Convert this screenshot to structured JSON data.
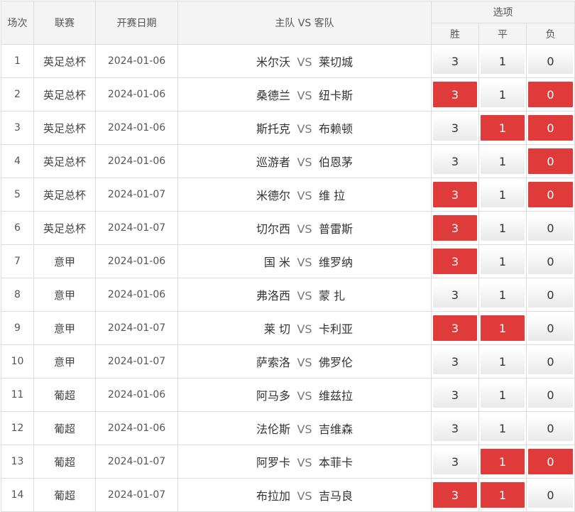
{
  "header": {
    "index": "场次",
    "league": "联赛",
    "date": "开赛日期",
    "matchup": "主队 VS 客队",
    "options": "选项",
    "win": "胜",
    "draw": "平",
    "lose": "负"
  },
  "colors": {
    "selected": "#e03b3b",
    "header_bg": "#f4f4f4",
    "border": "#dcdcdc"
  },
  "rows": [
    {
      "index": "1",
      "league": "英足总杯",
      "date": "2024-01-06",
      "home": "米尔沃",
      "vs": "VS",
      "away": "莱切城",
      "win": "3",
      "draw": "1",
      "lose": "0",
      "sel": []
    },
    {
      "index": "2",
      "league": "英足总杯",
      "date": "2024-01-06",
      "home": "桑德兰",
      "vs": "VS",
      "away": "纽卡斯",
      "win": "3",
      "draw": "1",
      "lose": "0",
      "sel": [
        "win",
        "lose"
      ]
    },
    {
      "index": "3",
      "league": "英足总杯",
      "date": "2024-01-06",
      "home": "斯托克",
      "vs": "VS",
      "away": "布赖顿",
      "win": "3",
      "draw": "1",
      "lose": "0",
      "sel": [
        "draw",
        "lose"
      ]
    },
    {
      "index": "4",
      "league": "英足总杯",
      "date": "2024-01-06",
      "home": "巡游者",
      "vs": "VS",
      "away": "伯恩茅",
      "win": "3",
      "draw": "1",
      "lose": "0",
      "sel": [
        "lose"
      ]
    },
    {
      "index": "5",
      "league": "英足总杯",
      "date": "2024-01-07",
      "home": "米德尔",
      "vs": "VS",
      "away": "维 拉",
      "win": "3",
      "draw": "1",
      "lose": "0",
      "sel": [
        "win",
        "lose"
      ]
    },
    {
      "index": "6",
      "league": "英足总杯",
      "date": "2024-01-07",
      "home": "切尔西",
      "vs": "VS",
      "away": "普雷斯",
      "win": "3",
      "draw": "1",
      "lose": "0",
      "sel": [
        "win"
      ]
    },
    {
      "index": "7",
      "league": "意甲",
      "date": "2024-01-06",
      "home": "国 米",
      "vs": "VS",
      "away": "维罗纳",
      "win": "3",
      "draw": "1",
      "lose": "0",
      "sel": [
        "win"
      ]
    },
    {
      "index": "8",
      "league": "意甲",
      "date": "2024-01-06",
      "home": "弗洛西",
      "vs": "VS",
      "away": "蒙 扎",
      "win": "3",
      "draw": "1",
      "lose": "0",
      "sel": []
    },
    {
      "index": "9",
      "league": "意甲",
      "date": "2024-01-07",
      "home": "莱 切",
      "vs": "VS",
      "away": "卡利亚",
      "win": "3",
      "draw": "1",
      "lose": "0",
      "sel": [
        "win",
        "draw"
      ]
    },
    {
      "index": "10",
      "league": "意甲",
      "date": "2024-01-07",
      "home": "萨索洛",
      "vs": "VS",
      "away": "佛罗伦",
      "win": "3",
      "draw": "1",
      "lose": "0",
      "sel": []
    },
    {
      "index": "11",
      "league": "葡超",
      "date": "2024-01-06",
      "home": "阿马多",
      "vs": "VS",
      "away": "维兹拉",
      "win": "3",
      "draw": "1",
      "lose": "0",
      "sel": []
    },
    {
      "index": "12",
      "league": "葡超",
      "date": "2024-01-06",
      "home": "法伦斯",
      "vs": "VS",
      "away": "吉维森",
      "win": "3",
      "draw": "1",
      "lose": "0",
      "sel": []
    },
    {
      "index": "13",
      "league": "葡超",
      "date": "2024-01-07",
      "home": "阿罗卡",
      "vs": "VS",
      "away": "本菲卡",
      "win": "3",
      "draw": "1",
      "lose": "0",
      "sel": [
        "draw",
        "lose"
      ]
    },
    {
      "index": "14",
      "league": "葡超",
      "date": "2024-01-07",
      "home": "布拉加",
      "vs": "VS",
      "away": "吉马良",
      "win": "3",
      "draw": "1",
      "lose": "0",
      "sel": [
        "win",
        "draw"
      ]
    }
  ]
}
